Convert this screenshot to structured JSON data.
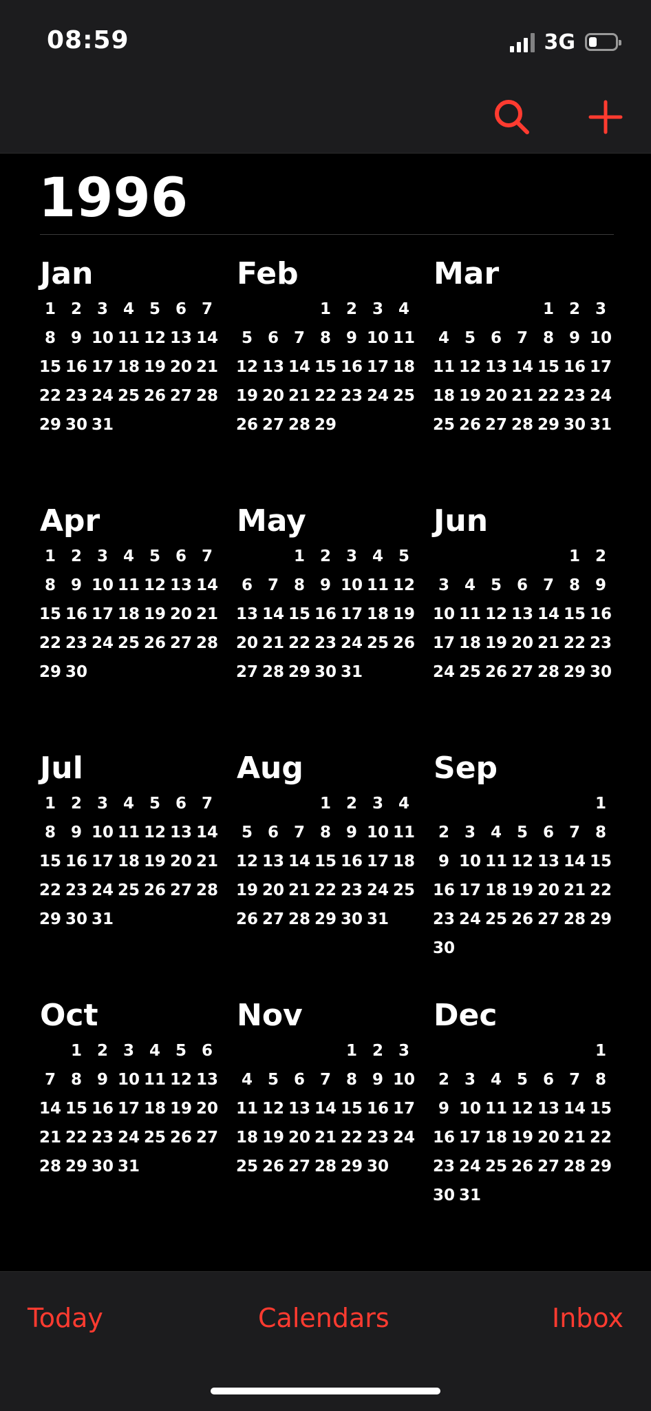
{
  "status_bar": {
    "time": "08:59",
    "network": "3G",
    "battery_level": 0.3
  },
  "toolbar": {
    "search_icon": "magnifying-glass",
    "add_icon": "plus",
    "accent_color": "#ff3b30"
  },
  "year": "1996",
  "weekday_start": "monday",
  "months": [
    {
      "name": "Jan",
      "offset": 0,
      "days": 31
    },
    {
      "name": "Feb",
      "offset": 3,
      "days": 29
    },
    {
      "name": "Mar",
      "offset": 4,
      "days": 31
    },
    {
      "name": "Apr",
      "offset": 0,
      "days": 30
    },
    {
      "name": "May",
      "offset": 2,
      "days": 31
    },
    {
      "name": "Jun",
      "offset": 5,
      "days": 30
    },
    {
      "name": "Jul",
      "offset": 0,
      "days": 31
    },
    {
      "name": "Aug",
      "offset": 3,
      "days": 31
    },
    {
      "name": "Sep",
      "offset": 6,
      "days": 30
    },
    {
      "name": "Oct",
      "offset": 1,
      "days": 31
    },
    {
      "name": "Nov",
      "offset": 4,
      "days": 30
    },
    {
      "name": "Dec",
      "offset": 6,
      "days": 31
    }
  ],
  "tabs": {
    "today": "Today",
    "calendars": "Calendars",
    "inbox": "Inbox"
  }
}
